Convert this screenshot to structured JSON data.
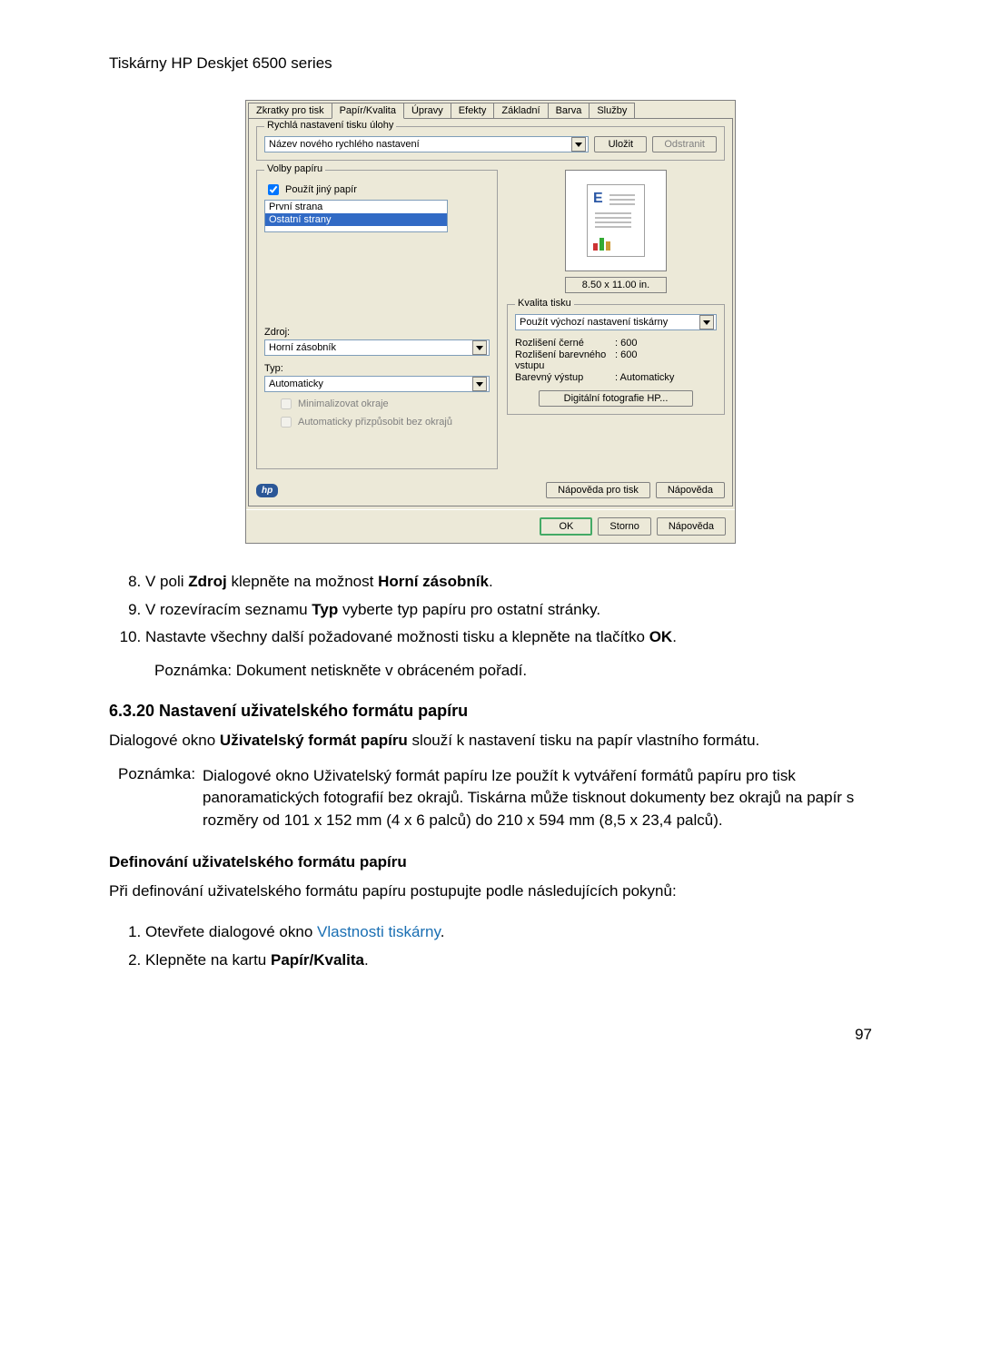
{
  "header": "Tiskárny HP Deskjet 6500 series",
  "dialog": {
    "tabs": [
      "Zkratky pro tisk",
      "Papír/Kvalita",
      "Úpravy",
      "Efekty",
      "Základní",
      "Barva",
      "Služby"
    ],
    "active_tab": "Papír/Kvalita",
    "quick_settings": {
      "title": "Rychlá nastavení tisku úlohy",
      "name": "Název nového rychlého nastavení",
      "save": "Uložit",
      "delete": "Odstranit"
    },
    "paper_options": {
      "title": "Volby papíru",
      "use_other": "Použít jiný papír",
      "first_page": "První strana",
      "other_pages": "Ostatní strany",
      "source_label": "Zdroj:",
      "source_value": "Horní zásobník",
      "type_label": "Typ:",
      "type_value": "Automaticky",
      "minimize_margins": "Minimalizovat okraje",
      "auto_fit": "Automaticky přizpůsobit bez okrajů"
    },
    "preview_size": "8.50 x 11.00 in.",
    "quality": {
      "title": "Kvalita tisku",
      "value": "Použít výchozí nastavení tiskárny",
      "res_black": "Rozlišení černé",
      "res_black_v": ": 600",
      "res_color": "Rozlišení barevného vstupu",
      "res_color_v": ": 600",
      "color_out": "Barevný výstup",
      "color_out_v": ": Automaticky",
      "hp_photo": "Digitální fotografie HP..."
    },
    "help_print": "Nápověda pro tisk",
    "help": "Nápověda",
    "ok": "OK",
    "cancel": "Storno",
    "help2": "Nápověda"
  },
  "steps1": [
    {
      "n": "8.",
      "t": "V poli ",
      "b1": "Zdroj",
      "t2": " klepněte na možnost ",
      "b2": "Horní zásobník",
      "t3": "."
    },
    {
      "n": "9.",
      "t": "V rozevíracím seznamu ",
      "b1": "Typ",
      "t2": " vyberte typ papíru pro ostatní stránky.",
      "b2": "",
      "t3": ""
    },
    {
      "n": "10.",
      "t": "Nastavte všechny další požadované možnosti tisku a klepněte na tlačítko ",
      "b1": "OK",
      "t2": ".",
      "b2": "",
      "t3": ""
    }
  ],
  "note1": "Poznámka:  Dokument netiskněte v obráceném pořadí.",
  "section_title": "6.3.20  Nastavení uživatelského formátu papíru",
  "section_p1a": "Dialogové okno ",
  "section_p1b": "Uživatelský formát papíru",
  "section_p1c": " slouží k nastavení tisku na papír vlastního formátu.",
  "note2_label": "Poznámka:",
  "note2_text": "Dialogové okno Uživatelský formát papíru lze použít k vytváření formátů papíru pro tisk panoramatických fotografií bez okrajů. Tiskárna může tisknout dokumenty bez okrajů na papír s rozměry od 101 x 152 mm (4 x 6 palců) do 210 x 594 mm (8,5 x 23,4 palců).",
  "sub_title": "Definování uživatelského formátu papíru",
  "sub_p": "Při definování uživatelského formátu papíru postupujte podle následujících pokynů:",
  "steps2": {
    "s1a": "Otevřete dialogové okno ",
    "s1b": "Vlastnosti tiskárny",
    "s1c": ".",
    "s2a": "Klepněte na kartu ",
    "s2b": "Papír/Kvalita",
    "s2c": "."
  },
  "page_number": "97"
}
